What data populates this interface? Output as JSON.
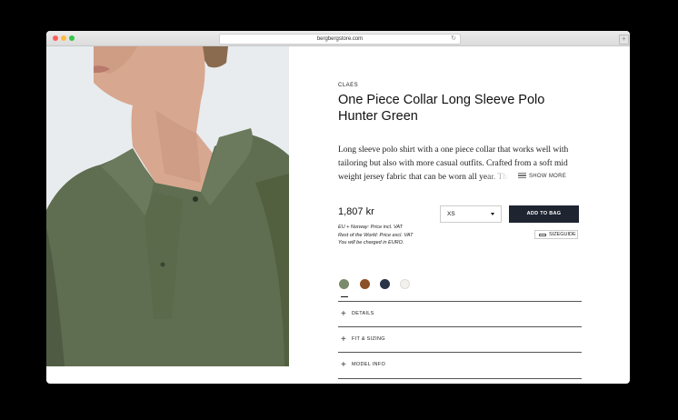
{
  "browser": {
    "url": "bergbergstore.com"
  },
  "product": {
    "brand": "CLAES",
    "title": "One Piece Collar Long Sleeve Polo Hunter Green",
    "description": "Long sleeve polo shirt with a one piece collar that works well with tailoring but also with more casual outfits. Crafted from a soft mid weight jersey fabric that can be worn all year. The polo has a comfortable regular fit.",
    "show_more": "SHOW MORE",
    "price": "1,807 kr",
    "vat_lines": [
      "EU + Norway: Price incl. VAT",
      "Rest of the World: Price excl. VAT",
      "You will be charged in EURO."
    ],
    "size_selected": "XS",
    "add_to_bag": "ADD TO BAG",
    "sizeguide": "SIZEGUIDE",
    "swatches": [
      "#7a8a6c",
      "#8b5127",
      "#2a3446",
      "#f2f1ec"
    ]
  },
  "accordion": [
    {
      "label": "DETAILS"
    },
    {
      "label": "FIT & SIZING"
    },
    {
      "label": "MODEL INFO"
    }
  ],
  "icons": [
    "reload-icon",
    "new-tab-icon",
    "lines-icon",
    "caret-down-icon",
    "ruler-icon",
    "plus-icon"
  ]
}
